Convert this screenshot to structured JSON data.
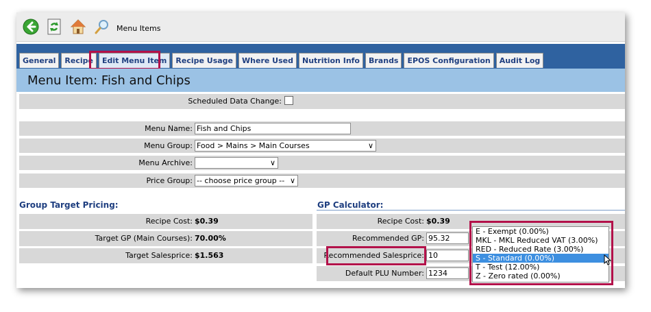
{
  "toolbar": {
    "title": "Menu Items"
  },
  "tabs": [
    {
      "label": "General"
    },
    {
      "label": "Recipe"
    },
    {
      "label": "Edit Menu Item"
    },
    {
      "label": "Recipe Usage"
    },
    {
      "label": "Where Used"
    },
    {
      "label": "Nutrition Info"
    },
    {
      "label": "Brands"
    },
    {
      "label": "EPOS Configuration"
    },
    {
      "label": "Audit Log"
    }
  ],
  "page": {
    "title": "Menu Item: Fish and Chips"
  },
  "scheduled": {
    "label": "Scheduled Data Change:"
  },
  "fields": {
    "menu_name": {
      "label": "Menu Name:",
      "value": "Fish and Chips"
    },
    "menu_group": {
      "label": "Menu Group:",
      "value": "Food > Mains > Main Courses"
    },
    "menu_archive": {
      "label": "Menu Archive:",
      "value": ""
    },
    "price_group": {
      "label": "Price Group:",
      "value": "-- choose price group --"
    }
  },
  "group_target": {
    "heading": "Group Target Pricing:",
    "recipe_cost": {
      "label": "Recipe Cost:",
      "value": "$0.39"
    },
    "target_gp": {
      "label": "Target GP (Main Courses):",
      "value": "70.00%"
    },
    "target_sales": {
      "label": "Target Salesprice:",
      "value": "$1.563"
    }
  },
  "gp_calc": {
    "heading": "GP Calculator:",
    "recipe_cost": {
      "label": "Recipe Cost:",
      "value": "$0.39"
    },
    "recommended_gp": {
      "label": "Recommended GP:",
      "value": "95.32"
    },
    "recommended_sales": {
      "label": "Recommended Salesprice:",
      "value": "10"
    },
    "default_plu": {
      "label": "Default PLU Number:",
      "value": "1234"
    }
  },
  "vat_options": [
    {
      "label": "E - Exempt (0.00%)"
    },
    {
      "label": "MKL - MKL Reduced VAT (3.00%)"
    },
    {
      "label": "RED - Reduced Rate (3.00%)"
    },
    {
      "label": "S - Standard (0.00%)"
    },
    {
      "label": "T - Test (12.00%)"
    },
    {
      "label": "Z - Zero rated (0.00%)"
    }
  ],
  "colors": {
    "accent_highlight": "#b3114a",
    "header_blue": "#2f62a0",
    "title_blue": "#9bc2e5",
    "selected_option": "#3d8fe0"
  }
}
